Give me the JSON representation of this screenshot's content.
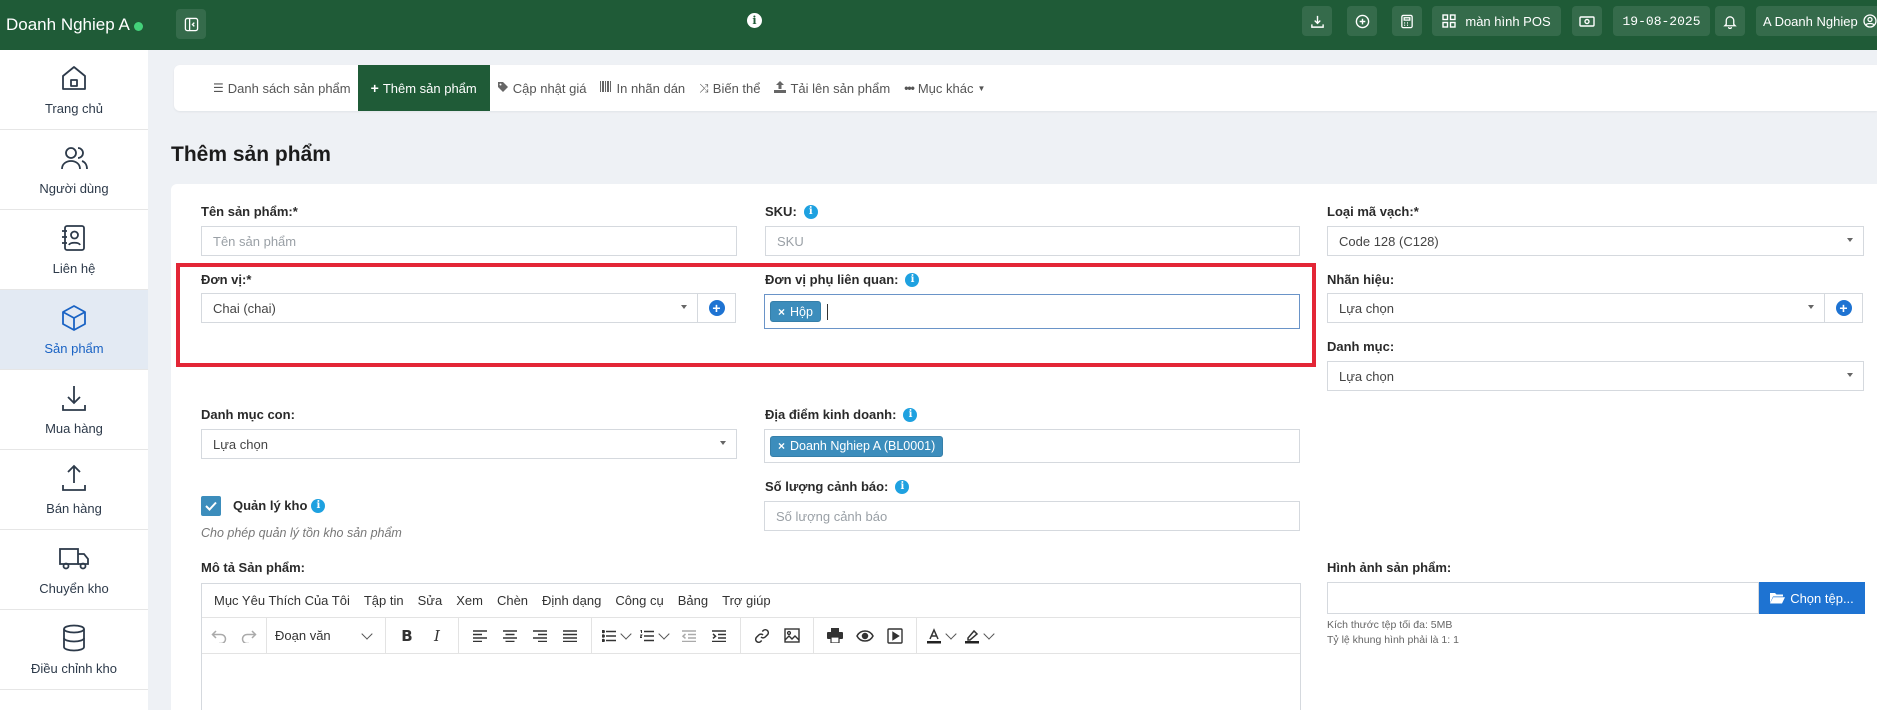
{
  "topbar": {
    "brand": "Doanh Nghiep A",
    "pos_label": "màn hình POS",
    "date": "19-08-2025",
    "user": "A Doanh Nghiep",
    "icons": [
      "sidebar-toggle-icon",
      "info-icon",
      "download-icon",
      "plus-circle-icon",
      "calculator-icon",
      "grid-icon",
      "cash-icon",
      "bell-icon",
      "user-circle-icon"
    ]
  },
  "sidebar": {
    "items": [
      {
        "label": "Trang chủ",
        "icon": "home-icon"
      },
      {
        "label": "Người dùng",
        "icon": "users-icon"
      },
      {
        "label": "Liên hệ",
        "icon": "contacts-icon"
      },
      {
        "label": "Sản phẩm",
        "icon": "box-icon",
        "active": true
      },
      {
        "label": "Mua hàng",
        "icon": "download-arrow-icon"
      },
      {
        "label": "Bán hàng",
        "icon": "upload-arrow-icon"
      },
      {
        "label": "Chuyển kho",
        "icon": "truck-icon"
      },
      {
        "label": "Điều chỉnh kho",
        "icon": "database-icon"
      }
    ]
  },
  "tabs": [
    {
      "label": "Danh sách sản phẩm",
      "icon": "list-icon"
    },
    {
      "label": "Thêm sản phẩm",
      "icon": "plus-icon",
      "active": true
    },
    {
      "label": "Cập nhật giá",
      "icon": "tag-icon"
    },
    {
      "label": "In nhãn dán",
      "icon": "barcode-icon"
    },
    {
      "label": "Biến thể",
      "icon": "shuffle-icon"
    },
    {
      "label": "Tải lên sản phẩm",
      "icon": "upload-icon"
    },
    {
      "label": "Mục khác",
      "icon": "ellipsis-icon"
    }
  ],
  "page": {
    "title": "Thêm sản phẩm"
  },
  "form": {
    "name_label": "Tên sản phẩm:*",
    "name_placeholder": "Tên sản phẩm",
    "sku_label": "SKU:",
    "sku_placeholder": "SKU",
    "barcode_label": "Loại mã vạch:*",
    "barcode_value": "Code 128 (C128)",
    "unit_label": "Đơn vị:*",
    "unit_value": "Chai (chai)",
    "sub_unit_label": "Đơn vị phụ liên quan:",
    "sub_unit_tag": "Hộp",
    "brand_label": "Nhãn hiệu:",
    "brand_value": "Lựa chọn",
    "category_label": "Danh mục:",
    "category_value": "Lựa chọn",
    "subcategory_label": "Danh mục con:",
    "subcategory_value": "Lựa chọn",
    "location_label": "Địa điểm kinh doanh:",
    "location_tag": "Doanh Nghiep A (BL0001)",
    "manage_stock_label": "Quản lý kho",
    "manage_stock_checked": true,
    "manage_stock_hint": "Cho phép quản lý tồn kho sản phẩm",
    "alert_qty_label": "Số lượng cảnh báo:",
    "alert_qty_placeholder": "Số lượng cảnh báo",
    "description_label": "Mô tả Sản phẩm:",
    "image_label": "Hình ảnh sản phẩm:",
    "image_button": "Chọn tệp...",
    "image_note_1": "Kích thước tệp tối đa: 5MB",
    "image_note_2": "Tỷ lệ khung hình phải là 1: 1"
  },
  "editor": {
    "menu": [
      "Mục Yêu Thích Của Tôi",
      "Tập tin",
      "Sửa",
      "Xem",
      "Chèn",
      "Định dạng",
      "Công cụ",
      "Bảng",
      "Trợ giúp"
    ],
    "paragraph": "Đoạn văn"
  },
  "colors": {
    "topbar": "#1f5b37",
    "active_tab": "#1f5b37",
    "tag": "#3c8dbc",
    "highlight": "#e32636",
    "primary": "#1e73d2"
  }
}
